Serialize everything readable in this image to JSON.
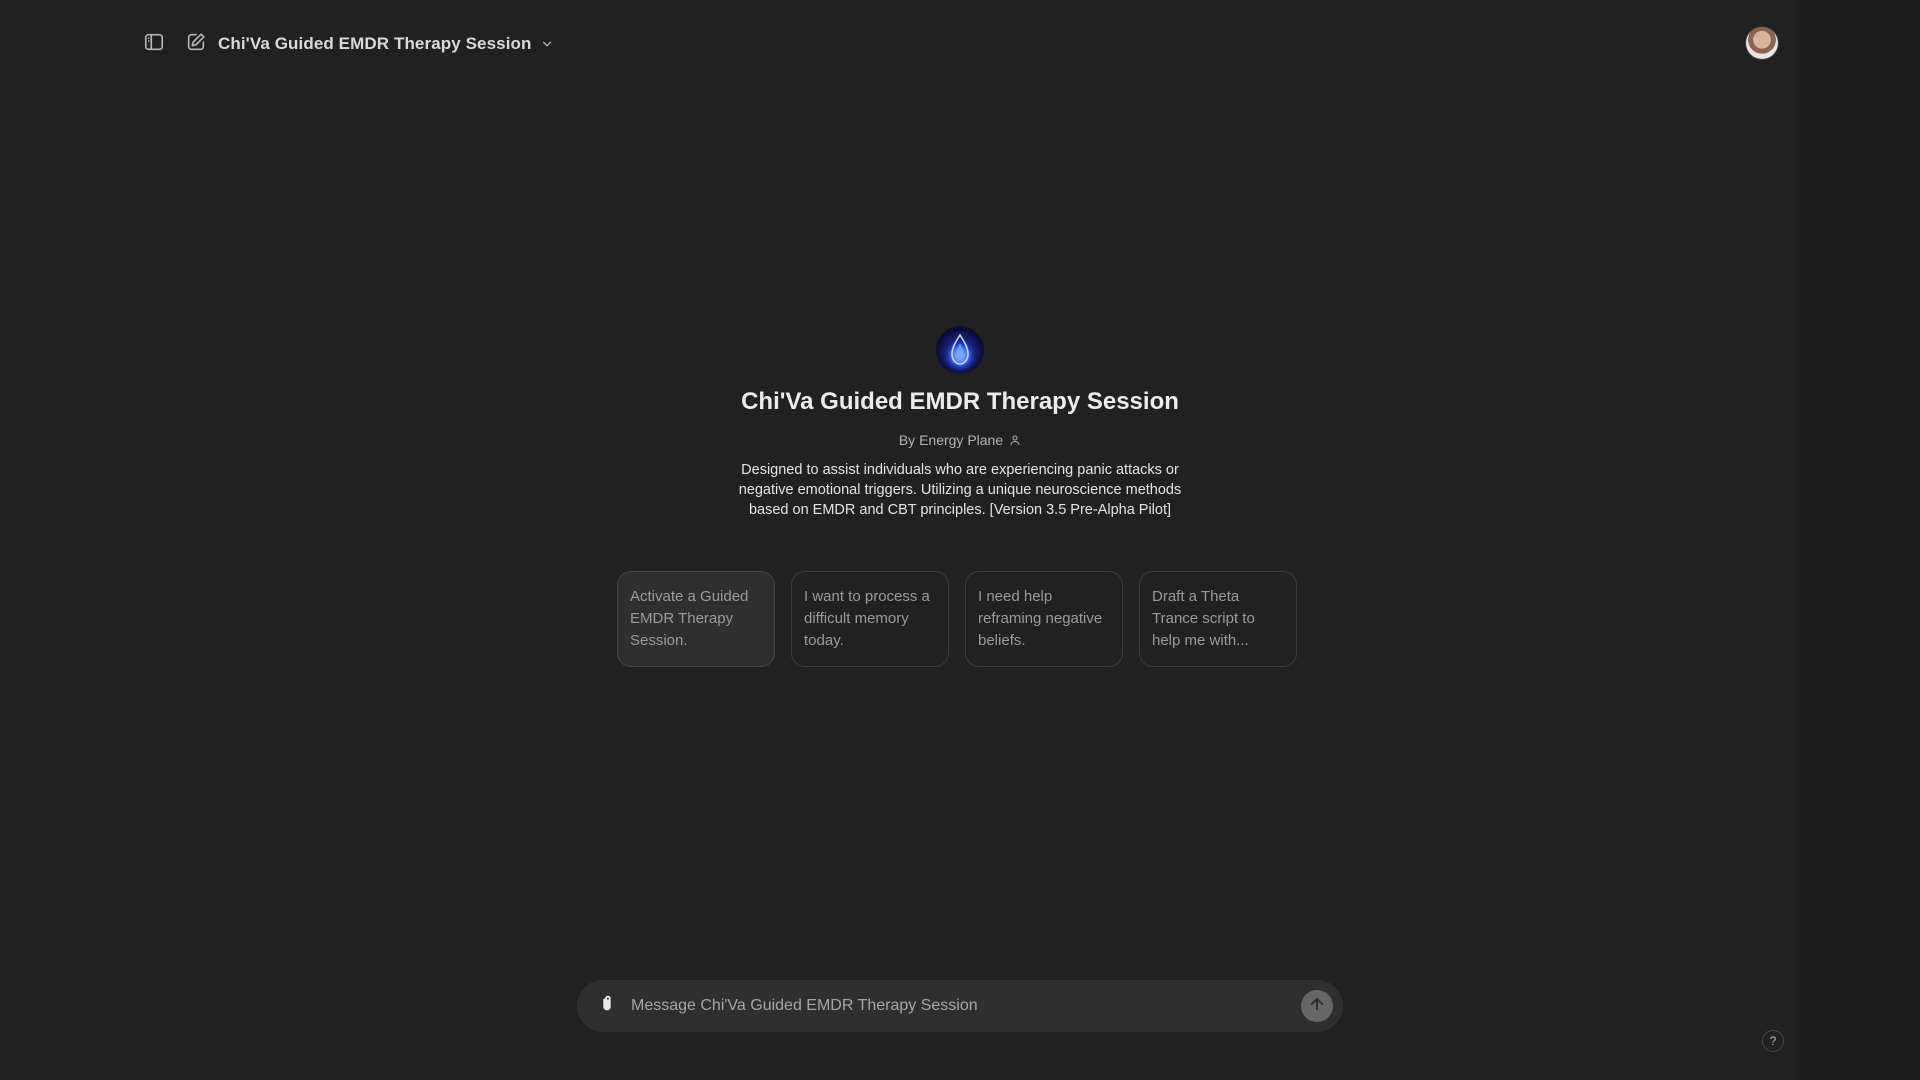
{
  "header": {
    "gpt_title": "Chi'Va Guided EMDR Therapy Session",
    "icons": [
      "sidebar-toggle-icon",
      "new-chat-icon",
      "chevron-down-icon"
    ]
  },
  "user": {
    "avatar_icon": "user-avatar"
  },
  "intro": {
    "name": "Chi'Va Guided EMDR Therapy Session",
    "author": "By Energy Plane",
    "description": "Designed to assist individuals who are experiencing panic attacks or negative emotional triggers. Utilizing a unique neuroscience methods based on EMDR and CBT principles. [Version 3.5 Pre-Alpha Pilot]"
  },
  "suggestions": [
    {
      "text": "Activate a Guided EMDR Therapy Session."
    },
    {
      "text": "I want to process a difficult memory today."
    },
    {
      "text": "I need help reframing negative beliefs."
    },
    {
      "text": "Draft a Theta Trance script to help me with..."
    }
  ],
  "composer": {
    "placeholder": "Message Chi'Va Guided EMDR Therapy Session",
    "value": ""
  },
  "help": {
    "label": "?"
  },
  "colors": {
    "background": "#212121",
    "surface": "#2f2f2f",
    "text": "#ececec",
    "muted": "#9b9b9b",
    "logo_accent": "#2b3eff"
  }
}
